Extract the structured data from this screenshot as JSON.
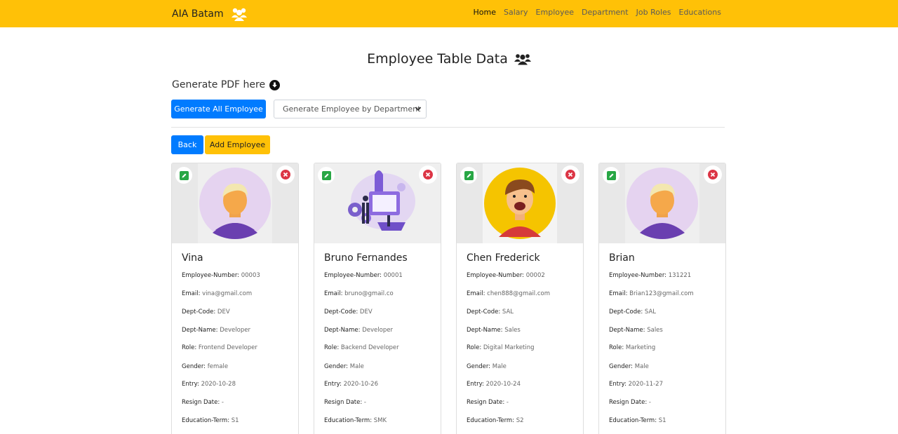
{
  "nav": {
    "brand": "AIA Batam",
    "links": [
      "Home",
      "Salary",
      "Employee",
      "Department",
      "Job Roles",
      "Educations"
    ]
  },
  "page": {
    "title": "Employee Table Data",
    "pdf_label": "Generate PDF here",
    "generate_all_label": "Generate All Employee",
    "dept_select": "Generate Employee by Department",
    "back_label": "Back",
    "add_label": "Add Employee"
  },
  "field_labels": {
    "number": "Employee-Number:",
    "email": "Email:",
    "dept_code": "Dept-Code:",
    "dept_name": "Dept-Name:",
    "role": "Role:",
    "gender": "Gender:",
    "entry": "Entry:",
    "resign": "Resign Date:",
    "education": "Education-Term:"
  },
  "employees": [
    {
      "name": "Vina",
      "number": "00003",
      "email": "vina@gmail.com",
      "dept_code": "DEV",
      "dept_name": "Developer",
      "role": "Frontend Developer",
      "gender": "female",
      "entry": "2020-10-28",
      "resign": "-",
      "education": "S1"
    },
    {
      "name": "Bruno Fernandes",
      "number": "00001",
      "email": "bruno@gmail.co",
      "dept_code": "DEV",
      "dept_name": "Developer",
      "role": "Backend Developer",
      "gender": "Male",
      "entry": "2020-10-26",
      "resign": "-",
      "education": "SMK"
    },
    {
      "name": "Chen Frederick",
      "number": "00002",
      "email": "chen888@gmail.com",
      "dept_code": "SAL",
      "dept_name": "Sales",
      "role": "Digital Marketing",
      "gender": "Male",
      "entry": "2020-10-24",
      "resign": "-",
      "education": "S2"
    },
    {
      "name": "Brian",
      "number": "131221",
      "email": "Brian123@gmail.com",
      "dept_code": "SAL",
      "dept_name": "Sales",
      "role": "Marketing",
      "gender": "Male",
      "entry": "2020-11-27",
      "resign": "-",
      "education": "S1"
    }
  ],
  "colors": {
    "navbar": "#ffc107",
    "primary": "#007bff",
    "warning": "#ffc107",
    "edit": "#28a745",
    "delete": "#dc3545"
  }
}
